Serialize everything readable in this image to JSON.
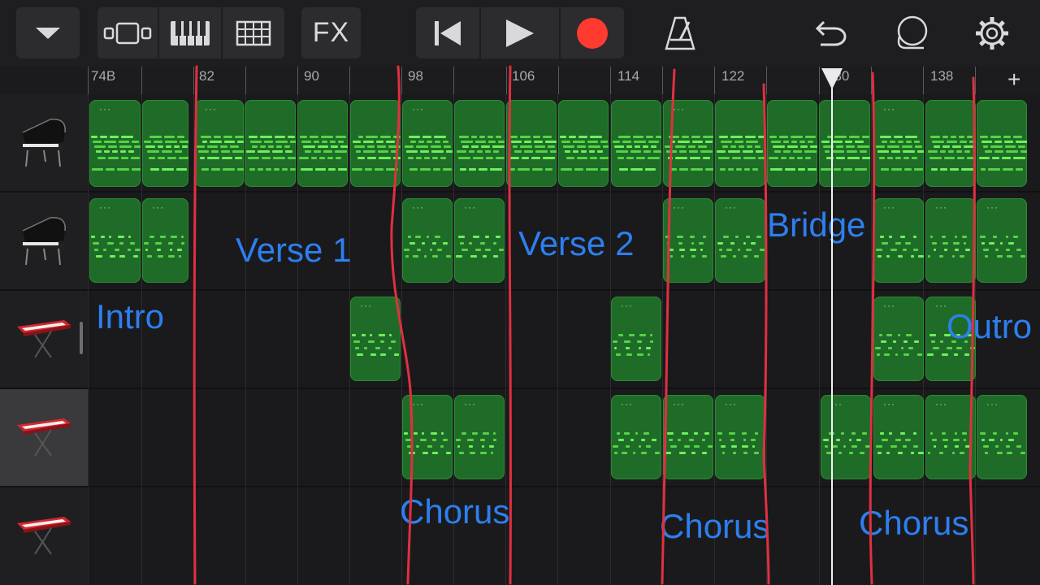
{
  "toolbar": {
    "menu_icon": "chevron-down-icon",
    "views": [
      "tracks-view-icon",
      "keyboard-icon",
      "grid-icon"
    ],
    "fx_label": "FX",
    "transport": [
      "rewind-icon",
      "play-icon",
      "record-icon"
    ],
    "metronome_icon": "metronome-icon",
    "undo_icon": "undo-icon",
    "loop_icon": "loop-icon",
    "settings_icon": "gear-icon",
    "record_color": "#ff3b30"
  },
  "ruler": {
    "labels": [
      "74B",
      "82",
      "90",
      "98",
      "106",
      "114",
      "122",
      "130",
      "138"
    ],
    "add_label": "+"
  },
  "tracks": [
    {
      "instrument": "grand-piano-icon"
    },
    {
      "instrument": "grand-piano-icon"
    },
    {
      "instrument": "synth-keyboard-icon"
    },
    {
      "instrument": "synth-keyboard-icon",
      "selected": true
    },
    {
      "instrument": "synth-keyboard-icon"
    }
  ],
  "regions": {
    "dots": "···"
  },
  "sections": {
    "intro": "Intro",
    "verse1": "Verse 1",
    "verse2": "Verse 2",
    "bridge": "Bridge",
    "outro": "Outro",
    "chorus1": "Chorus",
    "chorus2": "Chorus",
    "chorus3": "Chorus"
  },
  "annotation_color": "#e03040",
  "label_color": "#2d7ff0"
}
